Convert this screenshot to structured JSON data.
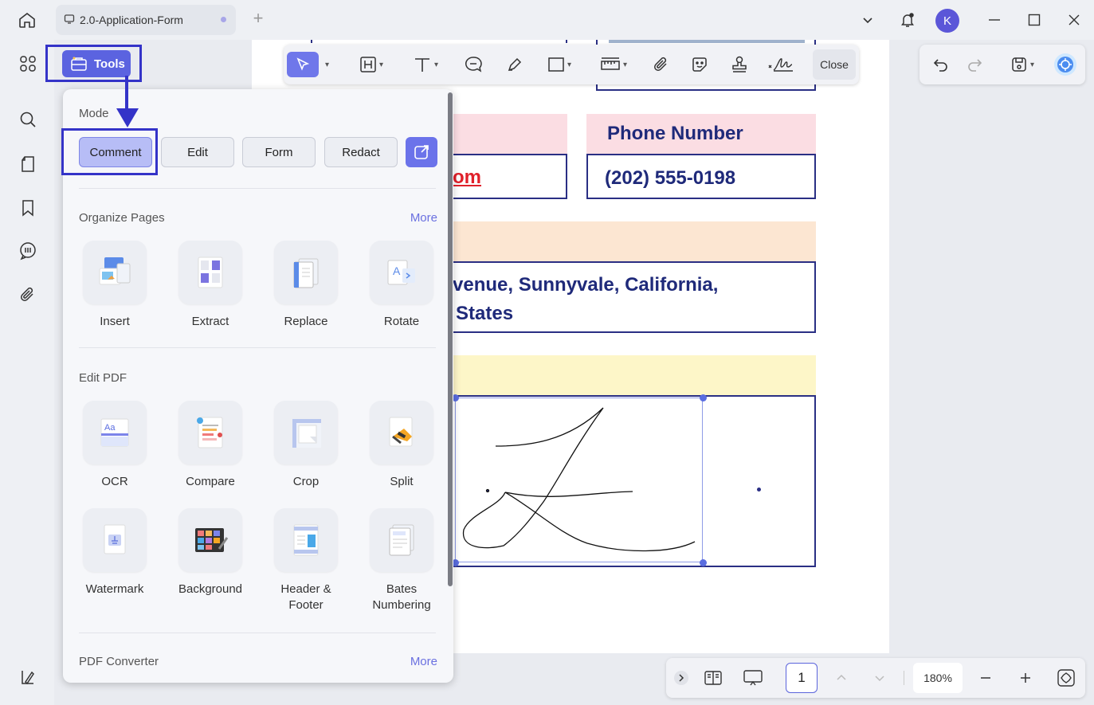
{
  "window": {
    "tab_title": "2.0-Application-Form",
    "avatar_initial": "K"
  },
  "toolbar": {
    "close_label": "Close"
  },
  "tools_button": {
    "label": "Tools"
  },
  "panel": {
    "mode": {
      "title": "Mode",
      "buttons": [
        "Comment",
        "Edit",
        "Form",
        "Redact"
      ],
      "active": "Comment"
    },
    "organize": {
      "title": "Organize Pages",
      "more": "More",
      "items": [
        "Insert",
        "Extract",
        "Replace",
        "Rotate"
      ]
    },
    "edit_pdf": {
      "title": "Edit PDF",
      "items": [
        "OCR",
        "Compare",
        "Crop",
        "Split",
        "Watermark",
        "Background",
        "Header & Footer",
        "Bates Numbering"
      ]
    },
    "converter": {
      "title": "PDF Converter",
      "more": "More"
    }
  },
  "document": {
    "email_fragment": "om",
    "phone_label": "Phone Number",
    "phone_value": "(202) 555-0198",
    "address_line1": "venue, Sunnyvale, California,",
    "address_line2": "States"
  },
  "bottom": {
    "page_number": "1",
    "zoom": "180%"
  },
  "colors": {
    "accent": "#5b63e0",
    "highlight_border": "#3433c8",
    "doc_text": "#1f2a7a",
    "pink_fill": "#fbdde3",
    "peach_fill": "#fce6d2",
    "yellow_fill": "#fdf6c8"
  }
}
